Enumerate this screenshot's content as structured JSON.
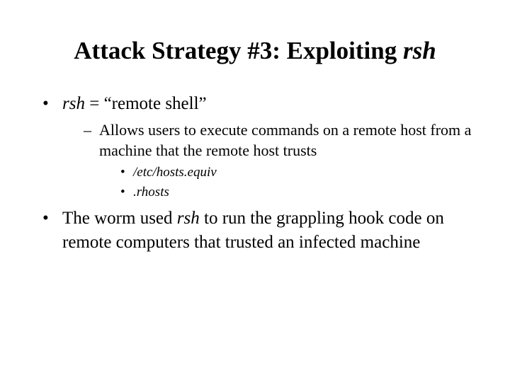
{
  "title": {
    "pre": "Attack Strategy #3: Exploiting ",
    "em": "rsh"
  },
  "bullets": {
    "b1": {
      "em": "rsh",
      "rest": " = “remote shell”",
      "sub": {
        "s1": "Allows users to execute commands on a remote host from a machine that the remote host trusts",
        "files": {
          "f1": "/etc/hosts.equiv",
          "f2": ".rhosts"
        }
      }
    },
    "b2": {
      "pre": "The worm used ",
      "em": "rsh",
      "post": " to run the grappling hook code on remote computers that trusted an infected machine"
    }
  }
}
